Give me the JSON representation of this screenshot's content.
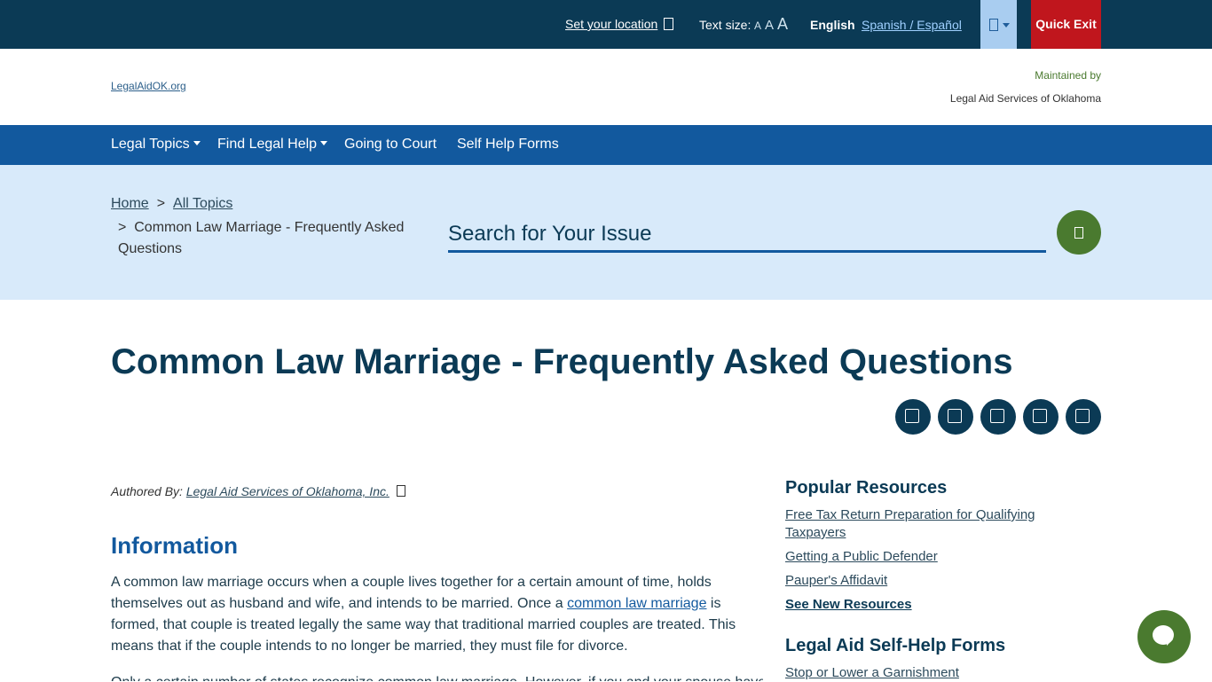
{
  "topbar": {
    "location_label": "Set your location",
    "text_size_label": "Text size:",
    "text_size_options": [
      "A",
      "A",
      "A"
    ],
    "lang_current": "English",
    "lang_other": "Spanish / Español",
    "quick_exit": "Quick Exit"
  },
  "header": {
    "logo_alt": "LegalAidOK.org",
    "maintained_by": "Maintained by",
    "maintainer_logo_alt": "Legal Aid Services of Oklahoma"
  },
  "nav": {
    "items": [
      "Legal Topics",
      "Find Legal Help",
      "Going to Court",
      "Self Help Forms"
    ]
  },
  "breadcrumb": {
    "home": "Home",
    "sep": ">",
    "all_topics": "All Topics",
    "current": "Common Law Marriage - Frequently Asked Questions"
  },
  "search": {
    "placeholder": "Search for Your Issue"
  },
  "page": {
    "title": "Common Law Marriage - Frequently Asked Questions",
    "authored_by_label": "Authored By:",
    "author": "Legal Aid Services of Oklahoma, Inc.",
    "section_heading": "Information",
    "para1_a": "A common law marriage occurs when a couple lives together for a certain amount of time, holds themselves out as husband and wife, and intends to be married. Once a ",
    "para1_link": "common law marriage",
    "para1_b": " is formed, that couple is treated legally the same way that traditional married couples are treated. This means that if the couple intends to no longer be married, they must file for divorce.",
    "para2": "Only a certain number of states recognize common law marriage. However, if you and your spouse have"
  },
  "sidebar": {
    "popular_heading": "Popular Resources",
    "popular_links": [
      "Free Tax Return Preparation for Qualifying Taxpayers",
      "Getting a Public Defender",
      "Pauper's Affidavit"
    ],
    "see_new": "See New Resources",
    "forms_heading": "Legal Aid Self-Help Forms",
    "forms_links": [
      "Stop or Lower a Garnishment"
    ]
  },
  "colors": {
    "topbar": "#0b3a55",
    "nav": "#12599e",
    "band": "#d8eafa",
    "accent_green": "#4a7a2f",
    "quick_exit": "#c0161d"
  }
}
